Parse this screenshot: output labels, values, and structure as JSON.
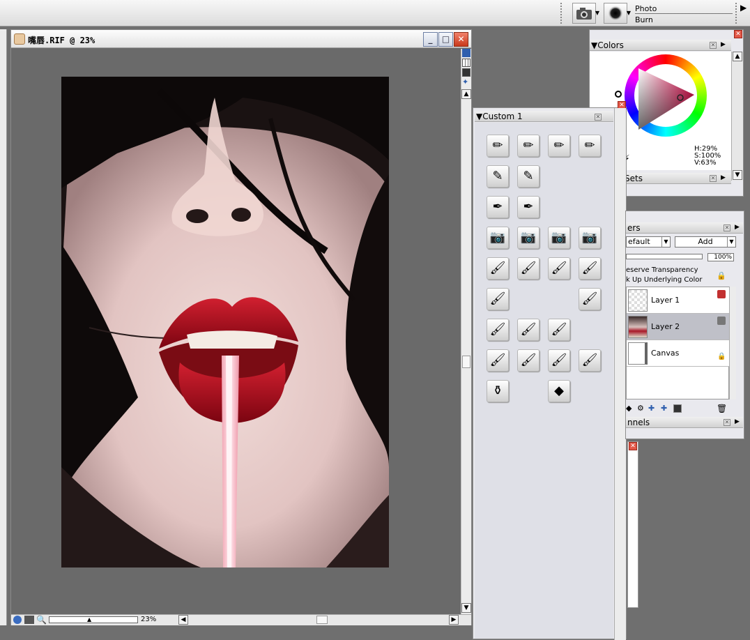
{
  "property_bar": {
    "variant_category": "Photo",
    "variant_name": "Burn",
    "category_icon": "camera-icon",
    "variant_icon": "brush-dab-icon"
  },
  "document": {
    "title": "嘴唇.RIF @ 23%",
    "zoom": "23%",
    "window_buttons": {
      "minimize": "_",
      "maximize": "□",
      "close": "✕"
    }
  },
  "colors_palette": {
    "title": "Colors",
    "hsv": {
      "h": "H:29%",
      "s": "S:100%",
      "v": "V:63%"
    },
    "sets_label": "Sets",
    "accent_colors": {
      "main": "#b11030",
      "wheel_ring": "rainbow"
    }
  },
  "custom_palette": {
    "title": "Custom  1",
    "rows": [
      [
        "pencil-icon",
        "pencil-icon",
        "pencil-icon",
        "pencil-icon"
      ],
      [
        "eraser-icon",
        "eraser-icon",
        "",
        ""
      ],
      [
        "pen-icon",
        "pen-icon",
        "",
        ""
      ],
      [
        "camera-icon",
        "camera-icon",
        "camera-icon",
        "camera-icon"
      ],
      [
        "water-brush-icon",
        "water-brush-icon",
        "water-brush-icon",
        "water-brush-icon"
      ],
      [
        "water-brush-icon",
        "",
        "",
        "water-brush-icon"
      ],
      [
        "oil-brush-icon",
        "oil-brush-icon",
        "oil-brush-icon",
        ""
      ],
      [
        "blender-brush-icon",
        "blender-brush-icon",
        "blender-brush-icon",
        "blender-brush-icon"
      ],
      [
        "ink-pot-icon",
        "",
        "palette-knife-icon",
        ""
      ]
    ]
  },
  "layers_palette": {
    "title": "ers",
    "composite_method": "efault",
    "composite_depth": "Add",
    "opacity": "100%",
    "preserve_transparency": "eserve Transparency",
    "pick_up_color": "k Up Underlying Color",
    "layers": [
      {
        "name": "Layer 1",
        "selected": false
      },
      {
        "name": "Layer 2",
        "selected": true
      },
      {
        "name": "Canvas",
        "selected": false
      }
    ],
    "channels_title": "nnels"
  }
}
